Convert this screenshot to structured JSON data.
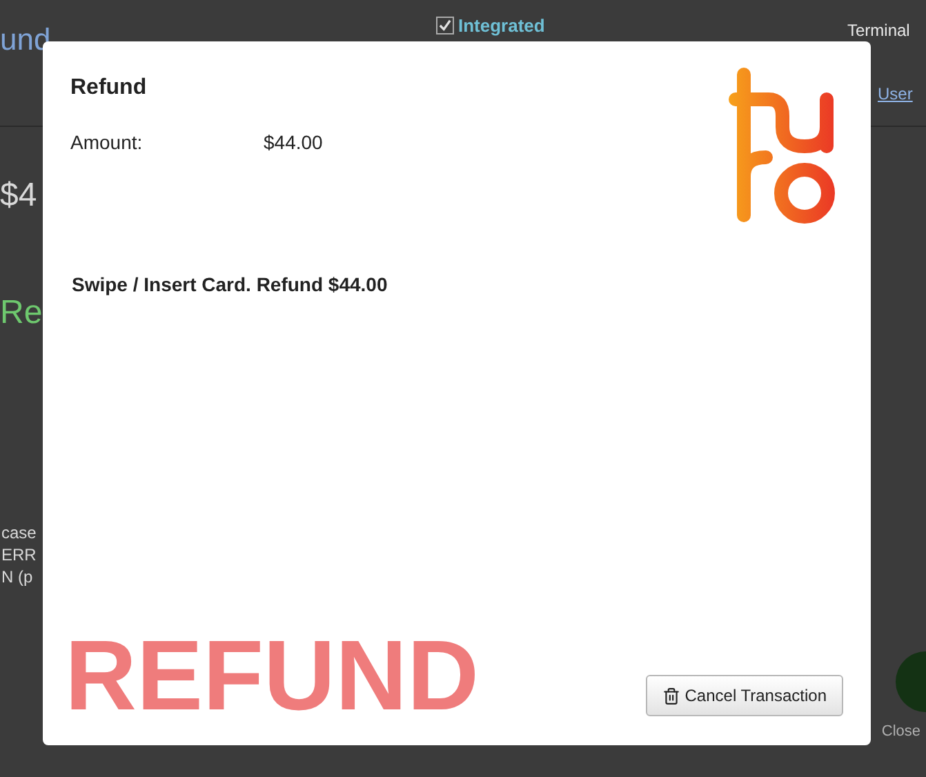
{
  "background_page": {
    "header_fragment": "und",
    "integrated": {
      "label": "Integrated",
      "checked": true
    },
    "terminal_label": "Terminal",
    "user_link": "User",
    "amount_fragment": "$4",
    "status_fragment": "Re",
    "log_lines": [
      "case",
      "ERR",
      "N (p"
    ],
    "close_label": "Close"
  },
  "dialog": {
    "title": "Refund",
    "amount_label": "Amount:",
    "amount_value": "$44.00",
    "message": "Swipe / Insert Card. Refund $44.00",
    "banner": "REFUND",
    "cancel_button": "Cancel Transaction"
  }
}
